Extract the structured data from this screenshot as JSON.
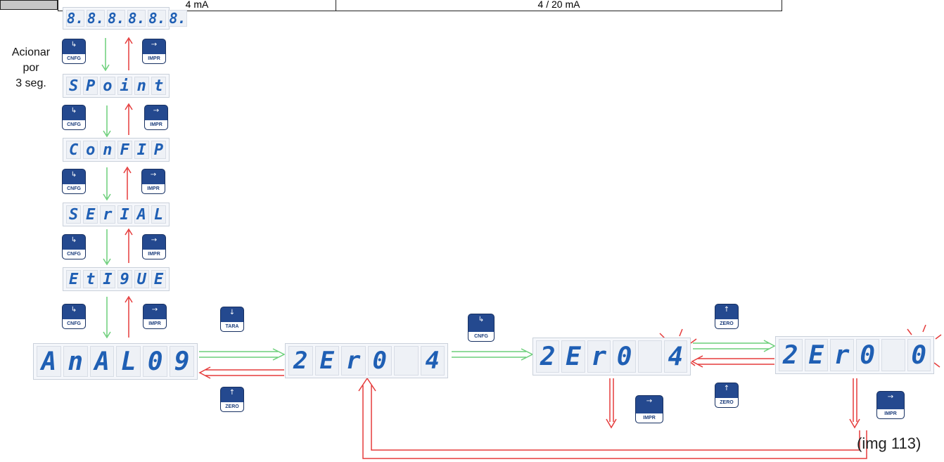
{
  "header": {
    "col1": "4 mA",
    "col2": "4 / 20 mA"
  },
  "colors": {
    "display_text": "#1f5fb4",
    "key_bg": "#24498f",
    "arrow_green": "#6ccf7a",
    "arrow_red": "#e53b3b"
  },
  "side_note": {
    "line1": "Acionar",
    "line2": "por",
    "line3": "3 seg."
  },
  "displays": {
    "test": [
      "8.",
      "8.",
      "8.",
      "8.",
      "8.",
      "8."
    ],
    "spoint": [
      "S",
      "P",
      "o",
      "i",
      "n",
      "t"
    ],
    "config": [
      "C",
      "o",
      "n",
      "F",
      "I",
      "P"
    ],
    "serial": [
      "S",
      "E",
      "r",
      "I",
      "A",
      "L"
    ],
    "etique": [
      "E",
      "t",
      "I",
      "9",
      "U",
      "E"
    ],
    "analog": [
      "A",
      "n",
      "A",
      "L",
      "0",
      "9"
    ],
    "zero4a": [
      "2",
      "E",
      "r",
      "0",
      "",
      "4"
    ],
    "zero4b": [
      "2",
      "E",
      "r",
      "0",
      "",
      "4"
    ],
    "zero0": [
      "2",
      "E",
      "r",
      "0",
      "",
      "0"
    ]
  },
  "keys": {
    "cnfg": {
      "label": "CNFG",
      "icon": "enter-icon",
      "glyph": "↳"
    },
    "impr": {
      "label": "IMPR",
      "icon": "right-arrow-icon",
      "glyph": "→"
    },
    "tara": {
      "label": "TARA",
      "icon": "down-arrow-icon",
      "glyph": "↓"
    },
    "zero": {
      "label": "ZERO",
      "icon": "up-arrow-icon",
      "glyph": "↑"
    }
  },
  "caption": "(img 113)"
}
